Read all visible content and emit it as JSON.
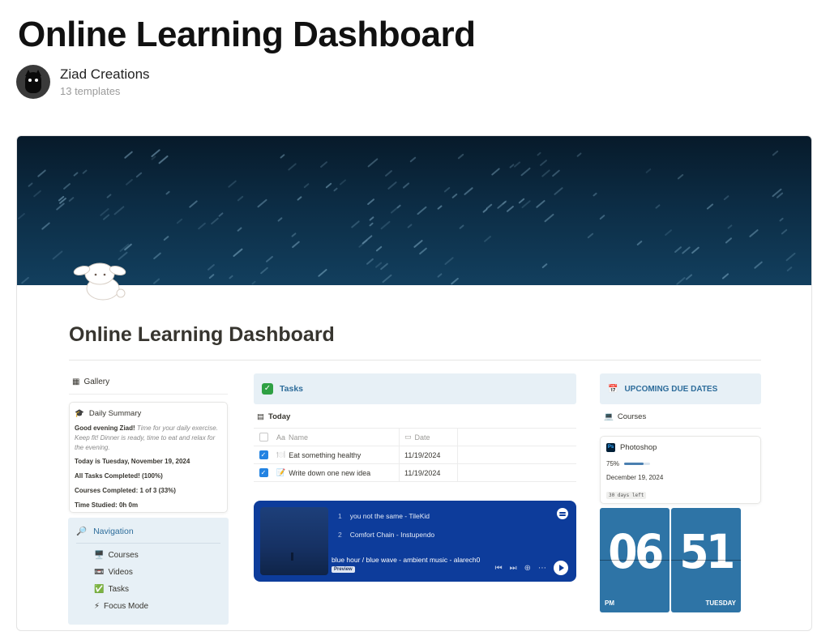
{
  "header": {
    "title": "Online Learning Dashboard",
    "author": "Ziad Creations",
    "author_sub": "13 templates"
  },
  "dashboard": {
    "title": "Online Learning Dashboard",
    "gallery_label": "Gallery",
    "summary": {
      "title": "Daily Summary",
      "greeting": "Good evening Ziad!",
      "message": "Time for your daily exercise. Keep fit!  Dinner is ready, time to eat and relax for the evening.",
      "today": "Today is Tuesday, November 19, 2024",
      "tasks": "All Tasks Completed!  (100%)",
      "courses": "Courses Completed: 1 of 3 (33%)",
      "studied": "Time Studied: 0h 0m"
    },
    "navigation": {
      "title": "Navigation",
      "items": [
        {
          "icon": "🖥️",
          "label": "Courses"
        },
        {
          "icon": "📼",
          "label": "Videos"
        },
        {
          "icon": "✅",
          "label": "Tasks"
        },
        {
          "icon": "⚡",
          "label": "Focus Mode"
        }
      ]
    },
    "tasks": {
      "title": "Tasks",
      "view": "Today",
      "col_name": "Name",
      "col_date": "Date",
      "rows": [
        {
          "icon": "🍽️",
          "name": "Eat something healthy",
          "date": "11/19/2024",
          "done": true
        },
        {
          "icon": "📝",
          "name": "Write down one new idea",
          "date": "11/19/2024",
          "done": true
        }
      ]
    },
    "player": {
      "tracks": [
        {
          "num": "1",
          "title": "you not the same - TileKid"
        },
        {
          "num": "2",
          "title": "Comfort Chain - Instupendo"
        }
      ],
      "now_playing": "blue hour / blue wave - ambient music - alarech0",
      "badge": "Preview"
    },
    "due": {
      "title": "UPCOMING DUE DATES",
      "view": "Courses",
      "course": {
        "name": "Photoshop",
        "icon_text": "Ps",
        "progress_label": "75%",
        "progress": 0.75,
        "date": "December 19, 2024",
        "days_left": "30 days left"
      }
    },
    "clock": {
      "hours": "06",
      "minutes": "51",
      "ampm": "PM",
      "day": "TUESDAY"
    }
  },
  "colors": {
    "accent_blue": "#2e6d9b",
    "callout_bg": "#e7f0f6",
    "player_bg": "#0d3c9b",
    "clock_bg": "#2e74a6"
  }
}
